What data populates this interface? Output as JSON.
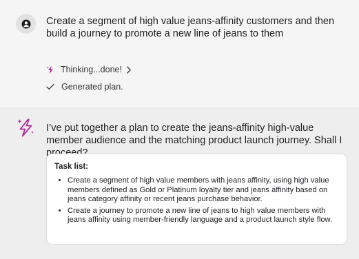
{
  "user": {
    "avatar_icon": "person-icon",
    "message": "Create a segment of high value jeans-affinity customers and then build a journey to promote a new line of jeans to them"
  },
  "status": {
    "thinking_icon": "sparkle-icon",
    "thinking_label": "Thinking...done!",
    "expand_icon": "chevron-right-icon",
    "plan_icon": "check-icon",
    "plan_label": "Generated plan."
  },
  "assistant": {
    "icon": "ai-sparkle-icon",
    "message": "I’ve put together a plan to create the jeans-affinity high-value member audience and the matching product launch journey. Shall I proceed?",
    "task_list": {
      "title": "Task list:",
      "items": [
        "Create a segment of high value members with jeans affinity, using high value members defined as Gold or Platinum loyalty tier and jeans affinity based on jeans category affinity or recent jeans purchase behavior.",
        "Create a journey to promote a new line of jeans to high value members with jeans affinity using member-friendly language and a product launch style flow."
      ]
    }
  },
  "colors": {
    "user_background": "#f5f5f5",
    "assistant_background": "#eeeeee",
    "accent_magenta": "#b5279a",
    "card_border": "#d9d9d9"
  }
}
